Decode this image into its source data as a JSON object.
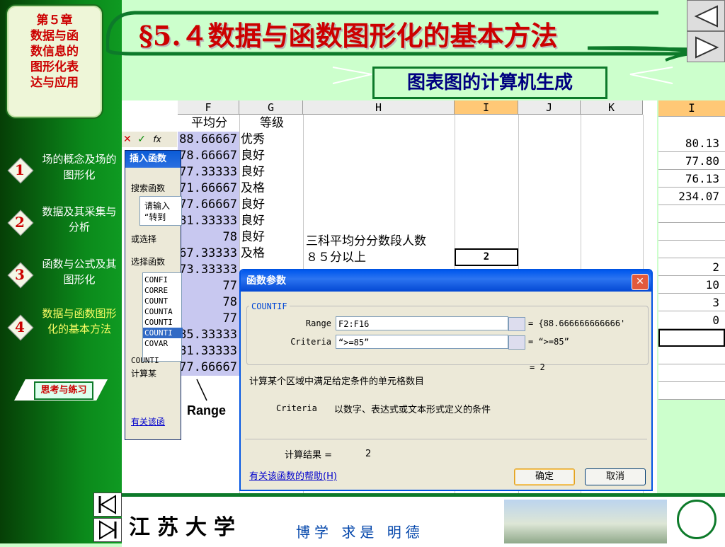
{
  "chapter": {
    "lines": [
      "第５章",
      "数据与函",
      "数信息的",
      "图形化表",
      "达与应用"
    ]
  },
  "nav": [
    {
      "num": "1",
      "label": "场的概念及场的图形化"
    },
    {
      "num": "2",
      "label": "数据及其采集与分析"
    },
    {
      "num": "3",
      "label": "函数与公式及其图形化"
    },
    {
      "num": "4",
      "label": "数据与函数图形化的基本方法"
    }
  ],
  "think_button": "思考与练习",
  "title": "§5.４数据与函数图形化的基本方法",
  "subtitle": "图表图的计算机生成",
  "sheet": {
    "col_headers": [
      "F",
      "G",
      "H",
      "I",
      "J",
      "K",
      "I"
    ],
    "header_row": {
      "F": "平均分",
      "G": "等级"
    },
    "rows": [
      {
        "F": "88.66667",
        "G": "优秀"
      },
      {
        "F": "78.66667",
        "G": "良好"
      },
      {
        "F": "77.33333",
        "G": "良好"
      },
      {
        "F": "71.66667",
        "G": "及格"
      },
      {
        "F": "77.66667",
        "G": "良好"
      },
      {
        "F": "81.33333",
        "G": "良好"
      },
      {
        "F": "78",
        "G": "良好"
      },
      {
        "F": "67.33333",
        "G": "及格"
      },
      {
        "F": "73.33333",
        "G": ""
      },
      {
        "F": "77",
        "G": ""
      },
      {
        "F": "78",
        "G": ""
      },
      {
        "F": "77",
        "G": ""
      },
      {
        "F": "85.33333",
        "G": ""
      },
      {
        "F": "81.33333",
        "G": ""
      },
      {
        "F": "77.66667",
        "G": ""
      }
    ],
    "h_texts": [
      "三科平均分分数段人数",
      "８５分以上"
    ],
    "i_value": "2",
    "range_label": "Range"
  },
  "right_col": [
    "80.13",
    "77.80",
    "76.13",
    "234.07",
    "2",
    "10",
    "3",
    "0"
  ],
  "insert_dialog": {
    "title": "插入函数",
    "search_label": "搜索函数",
    "search_hint_1": "请输入",
    "search_hint_2": "“转到",
    "or_select": "或选择",
    "select_func": "选择函数",
    "list": [
      "CONFI",
      "CORRE",
      "COUNT",
      "COUNTA",
      "COUNTI",
      "COUNTI",
      "COVAR"
    ],
    "footer_fn": "COUNTI",
    "footer_desc": "计算某",
    "help": "有关该函"
  },
  "formula_bar": {
    "cancel": "✕",
    "ok": "✓",
    "fx": "fx"
  },
  "args_dialog": {
    "title": "函数参数",
    "func_name": "COUNTIF",
    "range_label": "Range",
    "range_value": "F2:F16",
    "range_result": "= {88.666666666666'",
    "criteria_label": "Criteria",
    "criteria_value": "“>=85”",
    "criteria_result": "= “>=85”",
    "func_result": "= 2",
    "description": "计算某个区域中满足给定条件的单元格数目",
    "arg_desc_name": "Criteria",
    "arg_desc": "以数字、表达式或文本形式定义的条件",
    "calc_result_label": "计算结果 =",
    "calc_result_value": "2",
    "help_link": "有关该函数的帮助(H)",
    "ok": "确定",
    "cancel": "取消"
  },
  "bottom": {
    "university": "江苏大学",
    "motto": "博学 求是 明德"
  },
  "colors": {
    "title_red": "#cc0000",
    "green_dark": "#0d7a2a",
    "bg_green": "#ccffcc",
    "dialog_blue": "#0054e3"
  }
}
